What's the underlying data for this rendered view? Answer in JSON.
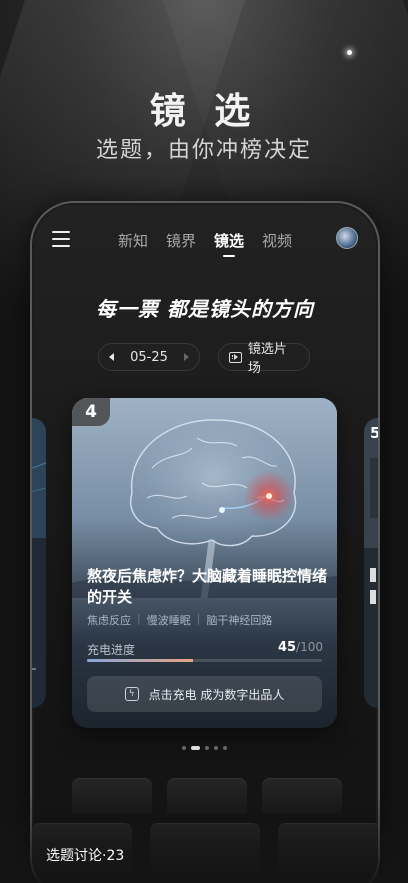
{
  "hero": {
    "title": "镜 选",
    "subtitle": "选题，由你冲榜决定"
  },
  "nav": {
    "tabs": [
      {
        "label": "新知",
        "active": false
      },
      {
        "label": "镜界",
        "active": false
      },
      {
        "label": "镜选",
        "active": true
      },
      {
        "label": "视频",
        "active": false
      }
    ]
  },
  "slogan": "每一票 都是镜头的方向",
  "date_selector": {
    "date": "05-25"
  },
  "venue_button": {
    "label": "镜选片场",
    "icon": "film-icon"
  },
  "card": {
    "rank": "4",
    "title": "熬夜后焦虑炸？大脑藏着睡眠控情绪的开关",
    "tags": [
      "焦虑反应",
      "慢波睡眠",
      "脑干神经回路"
    ],
    "charge_label": "充电进度",
    "charge_current": "45",
    "charge_total": "/100",
    "charge_fraction": 0.45,
    "button_label": "点击充电 成为数字出品人",
    "button_icon": "bolt-icon"
  },
  "next_card": {
    "rank": "5"
  },
  "pagination": {
    "count": 5,
    "active_index": 1
  },
  "footer": {
    "discussion": "选题讨论·23"
  },
  "colors": {
    "background": "#141414",
    "accent_bar_start": "#8aa5d8",
    "accent_bar_end": "#e4a384"
  }
}
